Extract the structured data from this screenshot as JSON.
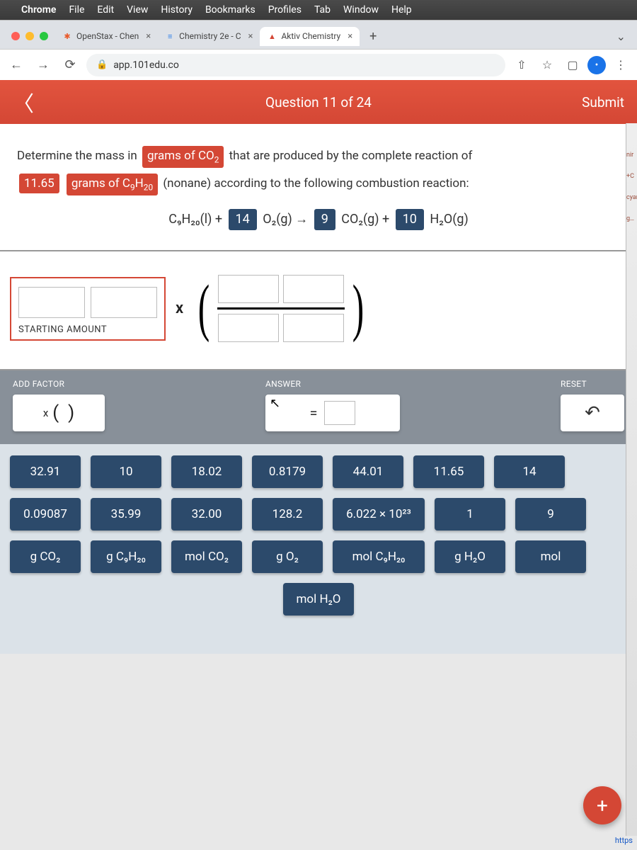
{
  "mac_menu": {
    "app": "Chrome",
    "items": [
      "File",
      "Edit",
      "View",
      "History",
      "Bookmarks",
      "Profiles",
      "Tab",
      "Window",
      "Help"
    ]
  },
  "browser": {
    "tabs": [
      {
        "label": "OpenStax - Chen",
        "favicon": "✱",
        "active": false
      },
      {
        "label": "Chemistry 2e - C",
        "favicon": "≡",
        "active": false
      },
      {
        "label": "Aktiv Chemistry",
        "favicon": "▲",
        "active": true
      }
    ],
    "url": "app.101edu.co"
  },
  "header": {
    "question_title": "Question 11 of 24",
    "submit_label": "Submit"
  },
  "question": {
    "part1": "Determine the mass in",
    "chip1": "grams of CO",
    "chip1_sub": "2",
    "part2": "that are produced by the complete reaction of",
    "chip2_value": "11.65",
    "chip3": "grams of C",
    "chip3_sub1": "9",
    "chip3_mid": "H",
    "chip3_sub2": "20",
    "part3": "(nonane) according to the following combustion reaction:"
  },
  "equation": {
    "reactant1": "C₉H₂₀(l) +",
    "coef1": "14",
    "reactant2": "O₂(g) →",
    "coef2": "9",
    "product1": "CO₂(g) +",
    "coef3": "10",
    "product2": "H₂O(g)"
  },
  "work": {
    "starting_label": "STARTING AMOUNT",
    "times": "x"
  },
  "controls": {
    "add_factor_label": "ADD FACTOR",
    "answer_label": "ANSWER",
    "reset_label": "RESET",
    "equals": "="
  },
  "keypad": {
    "row1": [
      "32.91",
      "10",
      "18.02",
      "0.8179",
      "44.01",
      "11.65",
      "14"
    ],
    "row2": [
      "0.09087",
      "35.99",
      "32.00",
      "128.2",
      "6.022 × 10²³",
      "1",
      "9"
    ],
    "row3": [
      "g CO₂",
      "g C₉H₂₀",
      "mol CO₂",
      "g O₂",
      "mol C₉H₂₀",
      "g H₂O",
      "mol"
    ],
    "row4": [
      "mol H₂O"
    ]
  },
  "fab": "+",
  "bottom": "https"
}
